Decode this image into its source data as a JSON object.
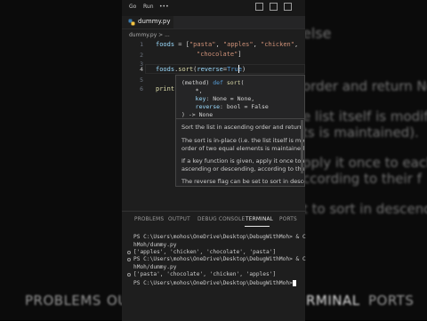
{
  "backdrop": {
    "top_right_text": "else",
    "right_lines": [
      "order and return No",
      "e list itself is modifie",
      "ts is maintained).",
      "pply it once to each",
      "ccording to their f",
      "t to sort in descend"
    ],
    "bottom_tabs": [
      "PROBLEMS",
      "OU",
      "RMINAL",
      "PORTS"
    ]
  },
  "window": {
    "menu": [
      "Go",
      "Run",
      "•••"
    ]
  },
  "editor": {
    "tab_label": "dummy.py",
    "breadcrumb": "dummy.py > ...",
    "line_numbers": [
      "1",
      "2",
      "3",
      "4",
      "5",
      "6"
    ],
    "lines": {
      "l1_var": "foods",
      "l1_op": " = [",
      "l1_s1": "\"pasta\"",
      "l1_c1": ", ",
      "l1_s2": "\"apples\"",
      "l1_c2": ", ",
      "l1_s3": "\"chicken\"",
      "l1_c3": ",",
      "l2_s4": "\"chocolate\"",
      "l2_end": "]",
      "l4_var": "foods",
      "l4_dot": ".",
      "l4_fn": "sort",
      "l4_open": "(",
      "l4_param": "reverse",
      "l4_eq": "=",
      "l4_val": "True",
      "l4_close": ")",
      "l6_fn": "print",
      "l6_open": "("
    }
  },
  "hover": {
    "sig1_a": "(method) ",
    "sig1_b": "def ",
    "sig1_c": "sort",
    "sig1_d": "(",
    "sig2": "    *,",
    "sig3_a": "    key",
    "sig3_b": ": None = None,",
    "sig4_a": "    reverse",
    "sig4_b": ": bool = False",
    "sig5": ") -> None",
    "doc": [
      "Sort the list in ascending order and return No",
      "The sort is in-place (i.e. the list itself is modifi",
      "order of two equal elements is maintained).",
      "If a key function is given, apply it once to eac",
      "ascending or descending, according to their f",
      "The reverse flag can be set to sort in descend"
    ]
  },
  "panel": {
    "tabs": [
      "PROBLEMS",
      "OUTPUT",
      "DEBUG CONSOLE",
      "TERMINAL",
      "PORTS"
    ],
    "active_tab": "TERMINAL",
    "terminal": [
      "PS C:\\Users\\mohos\\OneDrive\\Desktop\\DebugWithMoh> & C",
      "hMoh/dummy.py",
      "['apples', 'chicken', 'chocolate', 'pasta']",
      "PS C:\\Users\\mohos\\OneDrive\\Desktop\\DebugWithMoh> & C",
      "hMoh/dummy.py",
      "['pasta', 'chocolate', 'chicken', 'apples']",
      "PS C:\\Users\\mohos\\OneDrive\\Desktop\\DebugWithMoh> "
    ]
  }
}
